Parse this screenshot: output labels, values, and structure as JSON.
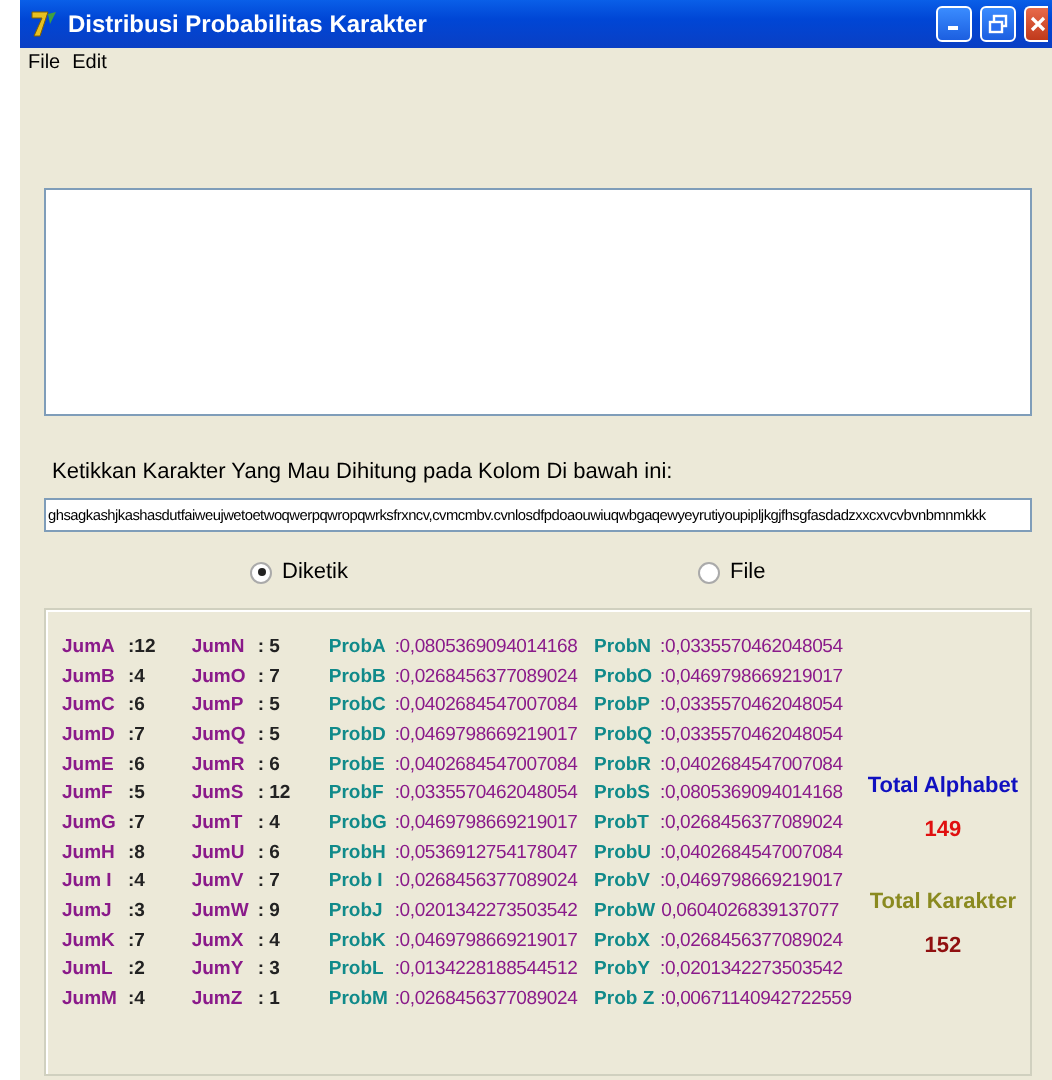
{
  "window": {
    "title": "Distribusi Probabilitas Karakter"
  },
  "menu": [
    "File",
    "Edit"
  ],
  "prompt": "Ketikkan Karakter Yang Mau Dihitung pada Kolom Di bawah ini:",
  "input": {
    "value": "ghsagkashjkashasdutfaiweujwetoetwoqwerpqwropqwrksfrxncv,cvmcmbv.cvnlosdfpdoaouwiuqwbgaqewyeyrutiyoupipljkgjfhsgfasdadzxxcxvcvbvnbmnmkkk"
  },
  "sources": [
    {
      "label": "Diketik",
      "selected": true
    },
    {
      "label": "File",
      "selected": false
    }
  ],
  "counts_1": [
    {
      "label": "JumA",
      "value": ":12"
    },
    {
      "label": "JumB",
      "value": ":4"
    },
    {
      "label": "JumC",
      "value": ":6"
    },
    {
      "label": "JumD",
      "value": ":7"
    },
    {
      "label": "JumE",
      "value": ":6"
    },
    {
      "label": "JumF",
      "value": ":5"
    },
    {
      "label": "JumG",
      "value": ":7"
    },
    {
      "label": "JumH",
      "value": ":8"
    },
    {
      "label": "Jum I",
      "value": ":4"
    },
    {
      "label": "JumJ",
      "value": ":3"
    },
    {
      "label": "JumK",
      "value": ":7"
    },
    {
      "label": "JumL",
      "value": ":2"
    },
    {
      "label": "JumM",
      "value": ":4"
    }
  ],
  "counts_2": [
    {
      "label": "JumN",
      "value": ": 5"
    },
    {
      "label": "JumO",
      "value": ": 7"
    },
    {
      "label": "JumP",
      "value": ": 5"
    },
    {
      "label": "JumQ",
      "value": ": 5"
    },
    {
      "label": "JumR",
      "value": ": 6"
    },
    {
      "label": "JumS",
      "value": ": 12"
    },
    {
      "label": "JumT",
      "value": ": 4"
    },
    {
      "label": "JumU",
      "value": ": 6"
    },
    {
      "label": "JumV",
      "value": ": 7"
    },
    {
      "label": "JumW",
      "value": ": 9"
    },
    {
      "label": "JumX",
      "value": ": 4"
    },
    {
      "label": "JumY",
      "value": ": 3"
    },
    {
      "label": "JumZ",
      "value": ": 1"
    }
  ],
  "probs_1": [
    {
      "label": "ProbA",
      "value": ":0,0805369094014168"
    },
    {
      "label": "ProbB",
      "value": ":0,0268456377089024"
    },
    {
      "label": "ProbC",
      "value": ":0,0402684547007084"
    },
    {
      "label": "ProbD",
      "value": ":0,0469798669219017"
    },
    {
      "label": "ProbE",
      "value": ":0,0402684547007084"
    },
    {
      "label": "ProbF",
      "value": ":0,0335570462048054"
    },
    {
      "label": "ProbG",
      "value": ":0,0469798669219017"
    },
    {
      "label": "ProbH",
      "value": ":0,0536912754178047"
    },
    {
      "label": "Prob I",
      "value": ":0,0268456377089024"
    },
    {
      "label": "ProbJ",
      "value": ":0,0201342273503542"
    },
    {
      "label": "ProbK",
      "value": ":0,0469798669219017"
    },
    {
      "label": "ProbL",
      "value": ":0,0134228188544512"
    },
    {
      "label": "ProbM",
      "value": ":0,0268456377089024"
    }
  ],
  "probs_2": [
    {
      "label": "ProbN",
      "value": ":0,0335570462048054"
    },
    {
      "label": "ProbO",
      "value": ":0,0469798669219017"
    },
    {
      "label": "ProbP",
      "value": ":0,0335570462048054"
    },
    {
      "label": "ProbQ",
      "value": ":0,0335570462048054"
    },
    {
      "label": "ProbR",
      "value": ":0,0402684547007084"
    },
    {
      "label": "ProbS",
      "value": ":0,0805369094014168"
    },
    {
      "label": "ProbT",
      "value": ":0,0268456377089024"
    },
    {
      "label": "ProbU",
      "value": ":0,0402684547007084"
    },
    {
      "label": "ProbV",
      "value": ":0,0469798669219017"
    },
    {
      "label": "ProbW",
      "value": "0,0604026839137077"
    },
    {
      "label": "ProbX",
      "value": ":0,0268456377089024"
    },
    {
      "label": "ProbY",
      "value": ":0,0201342273503542"
    },
    {
      "label": "Prob Z",
      "value": ":0,00671140942722559"
    }
  ],
  "totals": [
    {
      "label": "Total Alphabet",
      "value": "149"
    },
    {
      "label": "Total Karakter",
      "value": "152"
    }
  ]
}
